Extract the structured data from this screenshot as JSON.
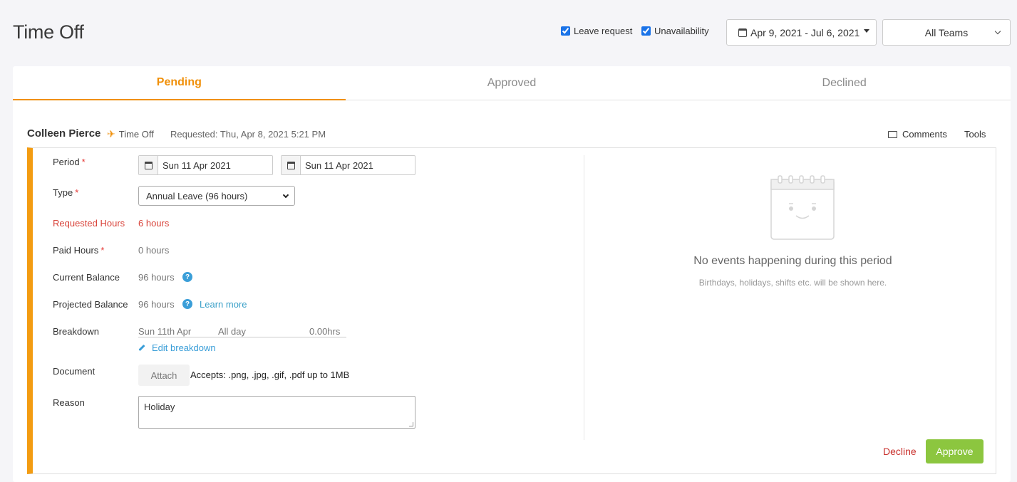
{
  "page": {
    "title": "Time Off"
  },
  "filters": {
    "leave_request": {
      "label": "Leave request",
      "checked": true
    },
    "unavailability": {
      "label": "Unavailability",
      "checked": true
    },
    "date_range": "Apr 9, 2021 - Jul 6, 2021",
    "team": "All Teams"
  },
  "tabs": [
    {
      "label": "Pending",
      "active": true
    },
    {
      "label": "Approved",
      "active": false
    },
    {
      "label": "Declined",
      "active": false
    }
  ],
  "request": {
    "name": "Colleen Pierce",
    "type": "Time Off",
    "requested": "Requested: Thu, Apr 8, 2021 5:21 PM",
    "comments_label": "Comments",
    "tools_label": "Tools"
  },
  "form": {
    "period": {
      "label": "Period",
      "required": "*",
      "start": "Sun 11 Apr 2021",
      "end": "Sun 11 Apr 2021"
    },
    "type": {
      "label": "Type",
      "required": "*",
      "value": "Annual Leave (96 hours)"
    },
    "requested_hours": {
      "label": "Requested Hours",
      "value": "6 hours"
    },
    "paid_hours": {
      "label": "Paid Hours",
      "required": "*",
      "value": "0 hours"
    },
    "current_balance": {
      "label": "Current Balance",
      "value": "96 hours"
    },
    "projected_balance": {
      "label": "Projected Balance",
      "value": "96 hours",
      "link": "Learn more"
    },
    "breakdown": {
      "label": "Breakdown",
      "rows": [
        {
          "date": "Sun 11th Apr",
          "period": "All day",
          "hours": "0.00hrs"
        }
      ],
      "edit_label": "Edit breakdown"
    },
    "document": {
      "label": "Document",
      "button": "Attach",
      "note": "Accepts: .png, .jpg, .gif, .pdf up to 1MB"
    },
    "reason": {
      "label": "Reason",
      "value": "Holiday"
    }
  },
  "events": {
    "title": "No events happening during this period",
    "subtitle": "Birthdays, holidays, shifts etc. will be shown here."
  },
  "actions": {
    "decline": "Decline",
    "approve": "Approve"
  },
  "colors": {
    "accent": "#f0900a",
    "approve": "#8cc63f",
    "decline": "#c9302c",
    "link": "#3a9ed8"
  }
}
